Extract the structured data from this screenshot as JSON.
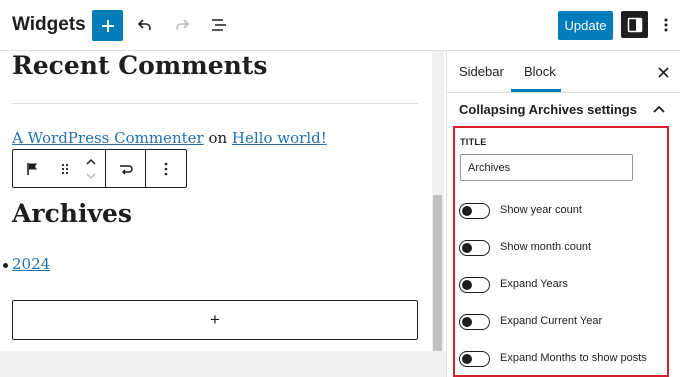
{
  "header": {
    "title": "Widgets",
    "update_label": "Update"
  },
  "canvas": {
    "recent_heading": "Recent Comments",
    "comment": {
      "author": "A WordPress Commenter",
      "connector": " on ",
      "post": "Hello world!"
    },
    "archives_heading": "Archives",
    "archive_years": [
      "2024"
    ],
    "appender_symbol": "+"
  },
  "sidebar": {
    "tabs": [
      {
        "label": "Sidebar",
        "active": false
      },
      {
        "label": "Block",
        "active": true
      }
    ],
    "panel_title": "Collapsing Archives settings",
    "title_field": {
      "label": "TITLE",
      "value": "Archives"
    },
    "toggles": [
      {
        "label": "Show year count",
        "checked": false
      },
      {
        "label": "Show month count",
        "checked": false
      },
      {
        "label": "Expand Years",
        "checked": false
      },
      {
        "label": "Expand Current Year",
        "checked": false
      },
      {
        "label": "Expand Months to show posts",
        "checked": false
      }
    ]
  },
  "icons": {
    "add": "plus-icon",
    "undo": "undo-icon",
    "redo": "redo-icon",
    "list_view": "list-view-icon",
    "settings": "sidebar-toggle-icon",
    "options": "more-vertical-icon",
    "close": "close-icon",
    "panel_toggle": "chevron-up-icon",
    "block_type": "flag-icon",
    "drag": "drag-handle-icon",
    "move": "move-up-down-icon",
    "transform": "transform-icon",
    "block_options": "more-vertical-icon"
  },
  "colors": {
    "accent": "#007cba",
    "link": "#2271b1",
    "highlight": "#d4202b",
    "text": "#1e1e1e"
  }
}
